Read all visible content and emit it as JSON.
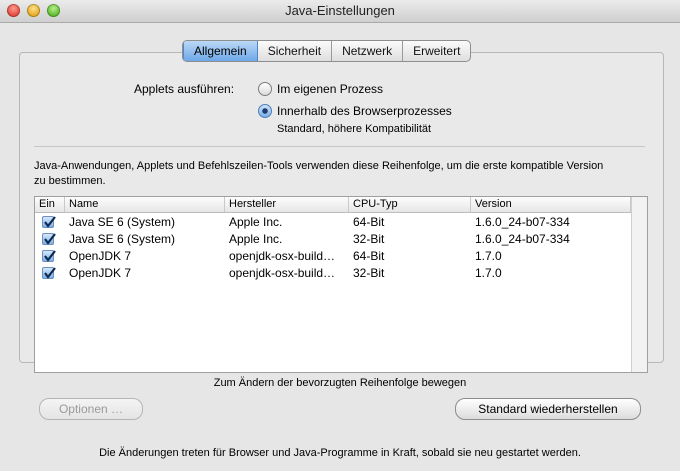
{
  "window": {
    "title": "Java-Einstellungen"
  },
  "tabs": [
    "Allgemein",
    "Sicherheit",
    "Netzwerk",
    "Erweitert"
  ],
  "applets": {
    "label": "Applets ausführen:",
    "option_own_process": "Im eigenen Prozess",
    "option_browser_process": "Innerhalb des Browserprozesses",
    "option_browser_hint": "Standard, höhere Kompatibilität",
    "selected": "option_browser_process"
  },
  "order_description": "Java-Anwendungen, Applets und Befehlszeilen-Tools verwenden diese Reihenfolge, um die erste kompatible Version",
  "order_description_2": "zu bestimmen.",
  "table": {
    "headers": [
      "Ein",
      "Name",
      "Hersteller",
      "CPU-Typ",
      "Version"
    ],
    "rows": [
      {
        "enabled": true,
        "name": "Java SE 6 (System)",
        "vendor": "Apple Inc.",
        "cpu": "64-Bit",
        "version": "1.6.0_24-b07-334"
      },
      {
        "enabled": true,
        "name": "Java SE 6 (System)",
        "vendor": "Apple Inc.",
        "cpu": "32-Bit",
        "version": "1.6.0_24-b07-334"
      },
      {
        "enabled": true,
        "name": "OpenJDK 7",
        "vendor": "openjdk-osx-build…",
        "cpu": "64-Bit",
        "version": "1.7.0"
      },
      {
        "enabled": true,
        "name": "OpenJDK 7",
        "vendor": "openjdk-osx-build…",
        "cpu": "32-Bit",
        "version": "1.7.0"
      }
    ]
  },
  "drag_hint": "Zum Ändern der bevorzugten Reihenfolge bewegen",
  "buttons": {
    "options": "Optionen …",
    "restore": "Standard wiederherstellen"
  },
  "footer": "Die Änderungen treten für Browser und Java-Programme in Kraft, sobald sie neu gestartet werden.",
  "colors": {
    "tab_active": "#6ea7e8",
    "checkbox": "#7fb0e6"
  }
}
